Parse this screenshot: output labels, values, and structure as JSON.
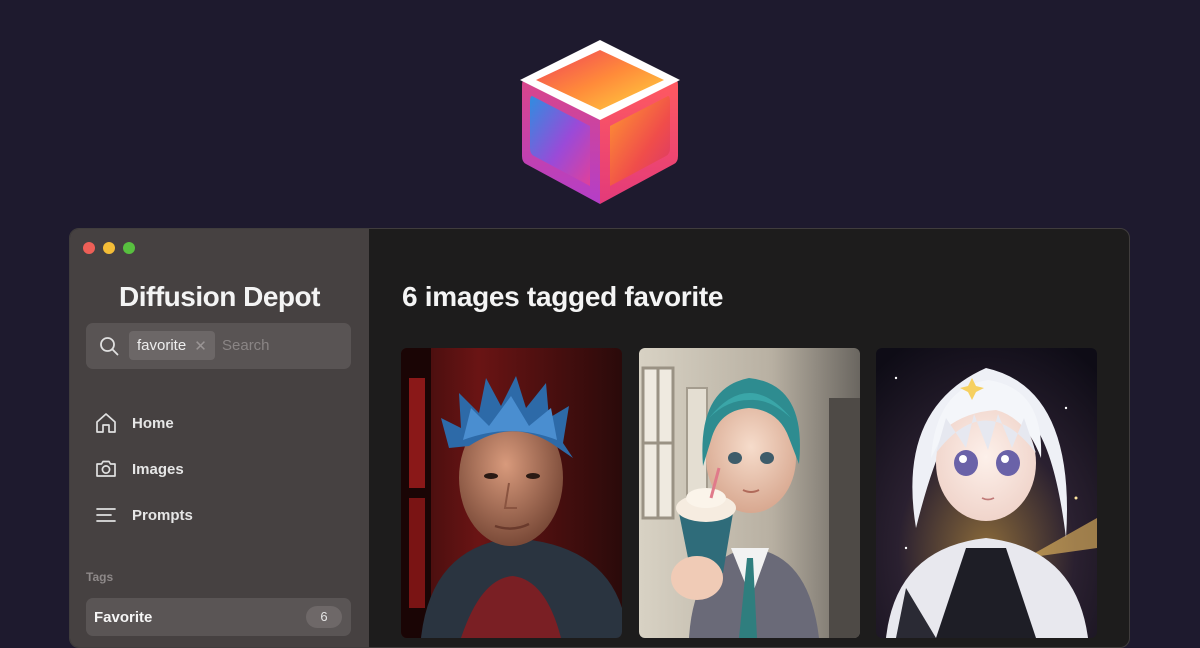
{
  "app": {
    "title": "Diffusion Depot"
  },
  "search": {
    "chip_label": "favorite",
    "chip_remove": "✕",
    "placeholder": "Search",
    "value": ""
  },
  "nav": [
    {
      "label": "Home",
      "icon": "home-icon"
    },
    {
      "label": "Images",
      "icon": "camera-icon"
    },
    {
      "label": "Prompts",
      "icon": "lines-icon"
    }
  ],
  "tags": {
    "heading": "Tags",
    "items": [
      {
        "label": "Favorite",
        "count": "6"
      }
    ]
  },
  "main": {
    "title": "6 images tagged favorite",
    "images": [
      {
        "subject": "portrait-man-blue-hair"
      },
      {
        "subject": "girl-teal-hair-cupcake"
      },
      {
        "subject": "anime-girl-white-hair"
      }
    ]
  },
  "colors": {
    "background": "#1e1a2e",
    "sidebar": "#464141",
    "window": "#1d1c1c",
    "traffic_red": "#ee5f57",
    "traffic_yellow": "#f4bd37",
    "traffic_green": "#58c03f"
  }
}
